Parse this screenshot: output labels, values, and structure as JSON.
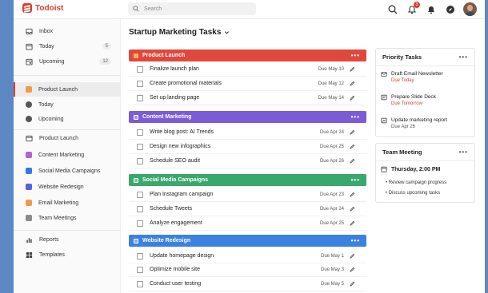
{
  "app": {
    "name": "Todoist",
    "brand_color": "#db4035"
  },
  "search": {
    "placeholder": "Search"
  },
  "topbar": {
    "notification_count": "3"
  },
  "sidebar": {
    "top_items": [
      {
        "label": "Inbox",
        "icon": "inbox-icon"
      },
      {
        "label": "Today",
        "icon": "calendar-today-icon",
        "count": "5"
      },
      {
        "label": "Upcoming",
        "icon": "calendar-upcoming-icon",
        "count": "12"
      }
    ],
    "active_project": {
      "label": "Product Launch",
      "color": "#f2994a"
    },
    "sub_items": [
      {
        "label": "Today"
      },
      {
        "label": "Upcoming"
      }
    ],
    "projects": [
      {
        "label": "Product Launch",
        "icon": "project-icon"
      },
      {
        "label": "Content Marketing",
        "color": "#b45fd6"
      },
      {
        "label": "Social Media Campaigns",
        "color": "#2d7be5"
      },
      {
        "label": "Website Redesign",
        "color": "#5b5ee0"
      },
      {
        "label": "Email Marketing",
        "color": "#f2994a"
      },
      {
        "label": "Team Meetings",
        "color": "#8a8a8a"
      }
    ],
    "footer": [
      {
        "label": "Reports"
      },
      {
        "label": "Templates"
      }
    ]
  },
  "main": {
    "title": "Startup Marketing Tasks",
    "sections": [
      {
        "name": "Product Launch",
        "color": "#e0483d",
        "tasks": [
          {
            "title": "Finalize launch plan",
            "due": "Due May 10"
          },
          {
            "title": "Create promotional materials",
            "due": "Due May 12"
          },
          {
            "title": "Set up landing page",
            "due": "Due May 14"
          }
        ]
      },
      {
        "name": "Content Marketing",
        "color": "#7b5cd6",
        "tasks": [
          {
            "title": "Write blog post: AI Trends",
            "due": "Due Apr 24"
          },
          {
            "title": "Design new infographics",
            "due": "Due Apr 25"
          },
          {
            "title": "Schedule SEO audit",
            "due": "Due Apr 26"
          }
        ]
      },
      {
        "name": "Social Media Campaigns",
        "color": "#3aa76d",
        "tasks": [
          {
            "title": "Plan Instagram campaign",
            "due": "Due Apr 23"
          },
          {
            "title": "Schedule Tweets",
            "due": "Due Apr 24"
          },
          {
            "title": "Analyze engagement",
            "due": "Due Apr 25"
          }
        ]
      },
      {
        "name": "Website Redesign",
        "color": "#3b82e0",
        "tasks": [
          {
            "title": "Update homepage design",
            "due": "Due May 1"
          },
          {
            "title": "Optimize mobile site",
            "due": "Due May 3"
          },
          {
            "title": "Conduct user testing",
            "due": "Due May 5"
          }
        ]
      }
    ]
  },
  "priority": {
    "title": "Priority Tasks",
    "items": [
      {
        "title": "Draft Email Newsletter",
        "due": "Due Today",
        "due_color": "#db4035"
      },
      {
        "title": "Prepare Slide Deck",
        "due": "Due Tomorrow",
        "due_color": "#db4035"
      },
      {
        "title": "Update marketing report",
        "due": "Due Apr 26",
        "due_color": "#555555"
      }
    ]
  },
  "meeting": {
    "title": "Team Meeting",
    "time": "Thursday, 2:00 PM",
    "agenda": [
      "Review campaign progress",
      "Discuss upcoming tasks"
    ]
  }
}
